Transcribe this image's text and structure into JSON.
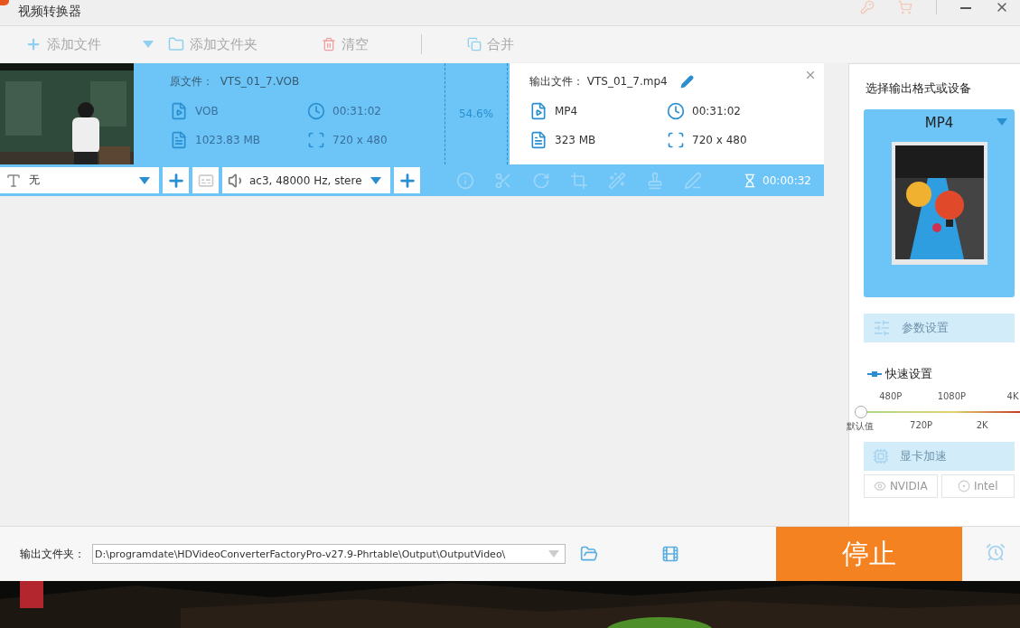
{
  "window": {
    "title": "视频转换器"
  },
  "toolbar": [
    {
      "kind": "add",
      "label": "添加文件",
      "disabled": true
    },
    {
      "kind": "folder",
      "label": "添加文件夹",
      "disabled": true
    },
    {
      "kind": "clear",
      "label": "清空",
      "disabled": true
    },
    {
      "kind": "merge",
      "label": "合并",
      "disabled": true
    }
  ],
  "task": {
    "source": {
      "label": "原文件：",
      "name": "VTS_01_7.VOB",
      "format": "VOB",
      "duration": "00:31:02",
      "size": "1023.83 MB",
      "resolution": "720 x 480"
    },
    "progress": "54.6%",
    "output": {
      "label": "输出文件：",
      "name": "VTS_01_7.mp4",
      "format": "MP4",
      "duration": "00:31:02",
      "size": "323 MB",
      "resolution": "720 x 480"
    },
    "subtitle": "无",
    "audio": "ac3, 48000 Hz, stere",
    "tools_disabled": true,
    "elapsed": "00:00:32"
  },
  "format_panel": {
    "title": "选择输出格式或设备",
    "format": "MP4",
    "params_button": {
      "label": "参数设置",
      "disabled": true
    },
    "quick_title": "快速设置",
    "slider": {
      "level": 0,
      "ticks": [
        {
          "label": "默认值",
          "kind": "below"
        },
        {
          "label": "480P",
          "kind": "above"
        },
        {
          "label": "720P",
          "kind": "below"
        },
        {
          "label": "1080P",
          "kind": "above"
        },
        {
          "label": "2K",
          "kind": "below"
        },
        {
          "label": "4K",
          "kind": "above"
        }
      ]
    },
    "gpu_button": {
      "label": "显卡加速",
      "disabled": true
    },
    "gpu_options": [
      {
        "label": "NVIDIA",
        "disabled": true
      },
      {
        "label": "Intel",
        "disabled": true
      }
    ]
  },
  "bottom_bar": {
    "folder_label": "输出文件夹：",
    "folder_path": "D:\\programdate\\HDVideoConverterFactoryPro-v27.9-Phrtable\\Output\\OutputVideo\\",
    "stop_button": "停止"
  }
}
